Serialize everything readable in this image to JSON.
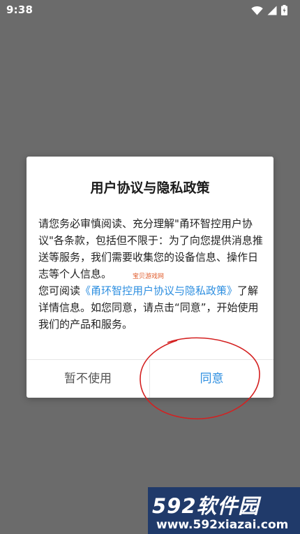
{
  "status_bar": {
    "time": "9:38",
    "icons": [
      "wifi-icon",
      "signal-icon",
      "battery-icon"
    ]
  },
  "dialog": {
    "title": "用户协议与隐私政策",
    "para1": "请您务必审慎阅读、充分理解\"甬环智控用户协议\"各条款，包括但不限于：为了向您提供消息推送等服务，我们需要收集您的设备信息、操作日志等个人信息。",
    "para2_prefix": "您可阅读",
    "para2_link": "《甬环智控用户协议与隐私政策》",
    "para2_suffix": "了解详情信息。如您同意，请点击“同意”，开始使用我们的产品和服务。",
    "decline_label": "暂不使用",
    "agree_label": "同意"
  },
  "colors": {
    "link": "#2e8fe0",
    "annotation": "#d42020",
    "backdrop": "#6b6b6b"
  },
  "watermarks": {
    "small": "宝贝游戏网",
    "logo_title": "592软件园",
    "logo_url": "www.592xiazai.com"
  }
}
